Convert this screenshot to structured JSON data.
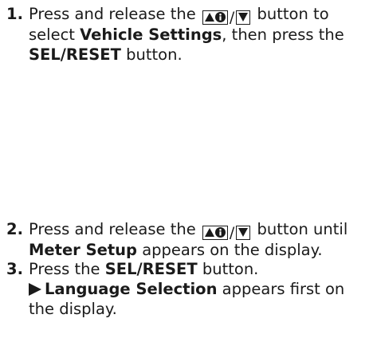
{
  "steps": [
    {
      "number": "1.",
      "text_before": "Press and release the",
      "text_after_button": "button to select",
      "bold_1": "Vehicle Settings",
      "text_mid": ", then press the",
      "bold_2": "SEL/RESET",
      "text_end": "button."
    },
    {
      "number": "2.",
      "text_before": "Press and release the",
      "text_after_button": "button until",
      "bold_1": "Meter Setup",
      "text_end": "appears on the display."
    },
    {
      "number": "3.",
      "text_before": "Press the",
      "bold_1": "SEL/RESET",
      "text_end": "button.",
      "result_bold": "Language Selection",
      "result_text": "appears first on the display."
    }
  ],
  "button_glyph": {
    "icons": [
      "triangle-up-icon",
      "info-icon",
      "triangle-down-icon"
    ],
    "separator": "/"
  }
}
